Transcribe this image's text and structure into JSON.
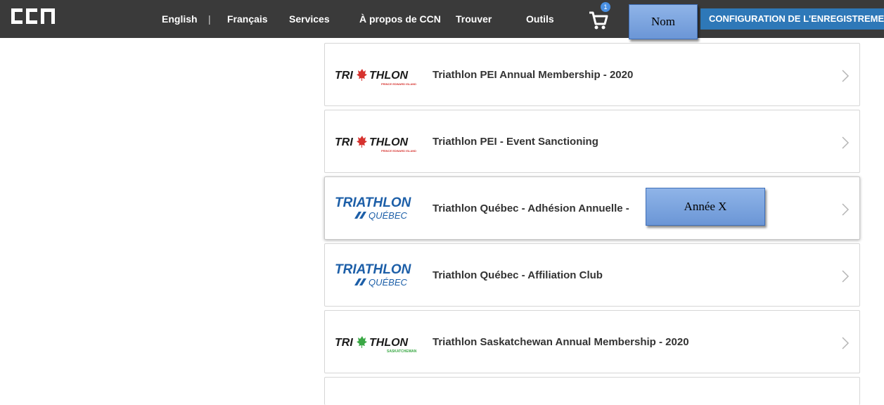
{
  "header": {
    "logo_text": "CCN",
    "nav": [
      "English",
      "|",
      "Français",
      "Services",
      "À propos de CCN",
      "Trouver",
      "Outils"
    ],
    "cart_count": "1",
    "config_button": "CONFIGURATION DE L'ENREGISTREMENT",
    "callout_name": "Nom"
  },
  "list": {
    "items": [
      {
        "title": "Triathlon PEI Annual Membership - 2020",
        "logo": {
          "main": "TRI THLON",
          "sub": "PRINCE EDWARD ISLAND"
        }
      },
      {
        "title": "Triathlon PEI - Event Sanctioning",
        "logo": {
          "main": "TRI THLON",
          "sub": "PRINCE EDWARD ISLAND"
        }
      },
      {
        "title": "Triathlon Québec - Adhésion Annuelle -",
        "logo": {
          "main": "TRIATHLON",
          "sub": "QUÉBEC"
        }
      },
      {
        "title": "Triathlon Québec - Affiliation Club",
        "logo": {
          "main": "TRIATHLON",
          "sub": "QUÉBEC"
        }
      },
      {
        "title": "Triathlon Saskatchewan Annual Membership - 2020",
        "logo": {
          "main": "TRI THLON",
          "sub": "SASKATCHEWAN"
        }
      }
    ],
    "callout_year": "Année X"
  },
  "colors": {
    "topbar": "#3a3a3a",
    "config_button": "#2e78b8",
    "quebec_blue": "#1d5fa8",
    "maple_red": "#d6322e",
    "maple_green": "#3aa845"
  }
}
